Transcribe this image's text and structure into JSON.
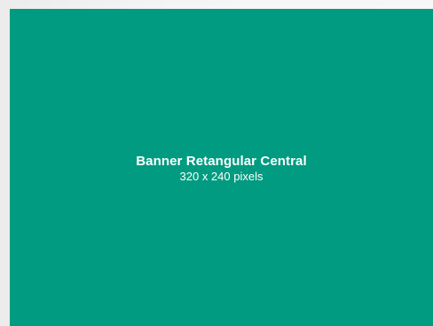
{
  "banner": {
    "title": "Banner Retangular Central",
    "size": "320 x 240 pixels",
    "background_color": "#009b80",
    "text_color": "#ffffff"
  },
  "page": {
    "background_color": "#f2f2f2"
  }
}
